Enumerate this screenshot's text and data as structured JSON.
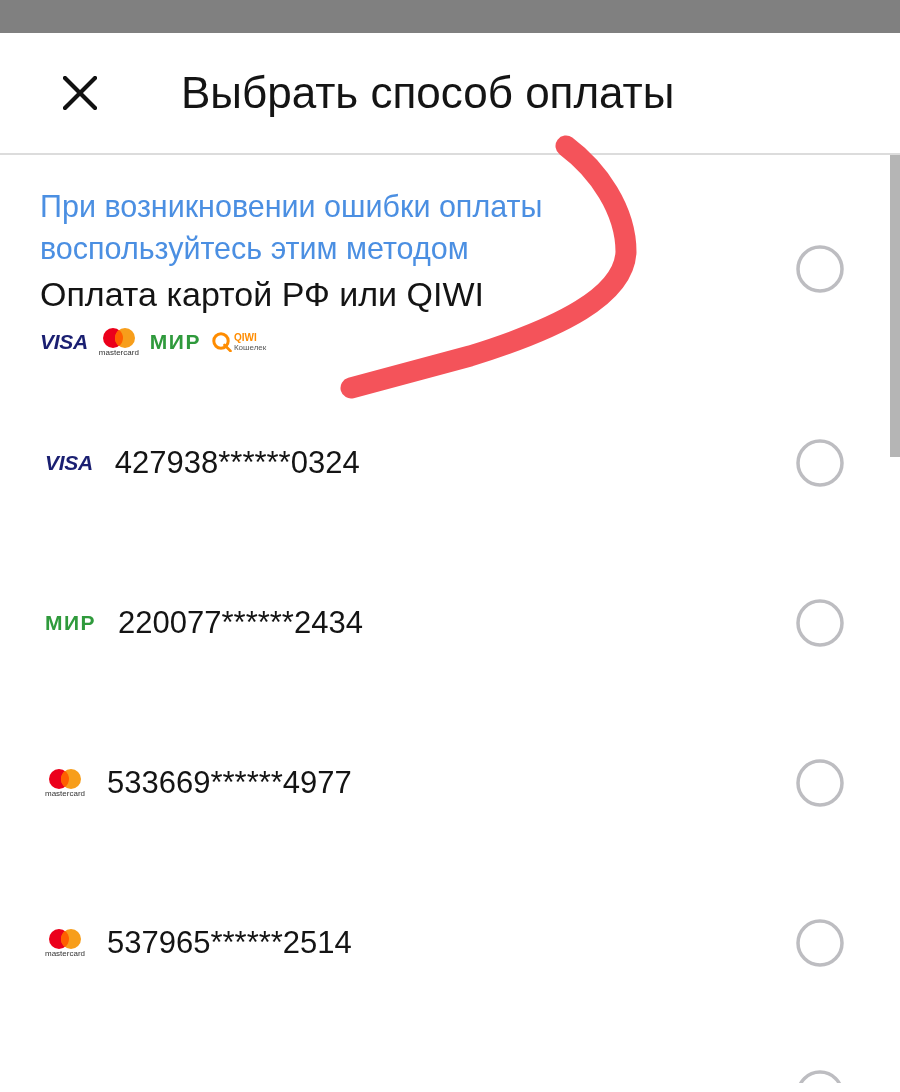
{
  "dimmed_backdrop": true,
  "header": {
    "title": "Выбрать способ оплаты"
  },
  "options": [
    {
      "kind": "method",
      "note": "При возникновении ошибки оплаты воспользуйтесь этим методом",
      "label": "Оплата картой РФ или QIWI",
      "logos": [
        {
          "kind": "visa",
          "text": "VISA"
        },
        {
          "kind": "mastercard",
          "text": "mastercard"
        },
        {
          "kind": "mir",
          "text": "МИР"
        },
        {
          "kind": "qiwi",
          "text": "QIWI",
          "subtext": "Кошелек"
        }
      ],
      "selected": false
    },
    {
      "kind": "card",
      "logo": {
        "kind": "visa",
        "text": "VISA"
      },
      "number": "427938******0324",
      "selected": false
    },
    {
      "kind": "card",
      "logo": {
        "kind": "mir",
        "text": "МИР"
      },
      "number": "220077******2434",
      "selected": false
    },
    {
      "kind": "card",
      "logo": {
        "kind": "mastercard",
        "text": "mastercard"
      },
      "number": "533669******4977",
      "selected": false
    },
    {
      "kind": "card",
      "logo": {
        "kind": "mastercard",
        "text": "mastercard"
      },
      "number": "537965******2514",
      "selected": false
    },
    {
      "kind": "partial",
      "selected": false
    }
  ],
  "hand_drawn_mark": true
}
